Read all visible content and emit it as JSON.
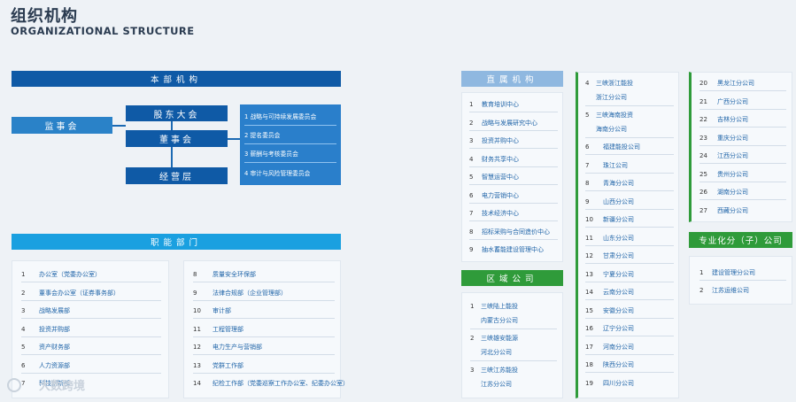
{
  "header": {
    "title_cn": "组织机构",
    "title_en": "ORGANIZATIONAL STRUCTURE"
  },
  "hq": {
    "label": "本部机构",
    "supervisors": "监事会",
    "shareholders": "股东大会",
    "board": "董事会",
    "management": "经营层",
    "committees": [
      "1  战略与可持续发展委员会",
      "2  提名委员会",
      "3  薪酬与考核委员会",
      "4  审计与风险管理委员会"
    ]
  },
  "functional": {
    "label": "职能部门",
    "left": [
      {
        "n": "1",
        "t": "办公室（党委办公室）"
      },
      {
        "n": "2",
        "t": "董事会办公室（证券事务部）"
      },
      {
        "n": "3",
        "t": "战略发展部"
      },
      {
        "n": "4",
        "t": "投资并购部"
      },
      {
        "n": "5",
        "t": "资产财务部"
      },
      {
        "n": "6",
        "t": "人力资源部"
      },
      {
        "n": "7",
        "t": "科技创新部"
      }
    ],
    "right": [
      {
        "n": "8",
        "t": "质量安全环保部"
      },
      {
        "n": "9",
        "t": "法律合规部（企业管理部）"
      },
      {
        "n": "10",
        "t": "审计部"
      },
      {
        "n": "11",
        "t": "工程管理部"
      },
      {
        "n": "12",
        "t": "电力生产与营销部"
      },
      {
        "n": "13",
        "t": "党群工作部"
      },
      {
        "n": "14",
        "t": "纪检工作部（党委巡察工作办公室、纪委办公室）"
      }
    ]
  },
  "direct": {
    "label": "直属机构",
    "items": [
      {
        "n": "1",
        "t": "教育培训中心"
      },
      {
        "n": "2",
        "t": "战略与发展研究中心"
      },
      {
        "n": "3",
        "t": "投资并购中心"
      },
      {
        "n": "4",
        "t": "财务共享中心"
      },
      {
        "n": "5",
        "t": "智慧运营中心"
      },
      {
        "n": "6",
        "t": "电力营销中心"
      },
      {
        "n": "7",
        "t": "技术经济中心"
      },
      {
        "n": "8",
        "t": "招标采购与合同造价中心"
      },
      {
        "n": "9",
        "t": "抽水蓄能建设管理中心"
      }
    ]
  },
  "regional": {
    "label": "区域公司",
    "items": [
      {
        "n": "1",
        "a": "三峡陆上能投",
        "b": "内蒙古分公司"
      },
      {
        "n": "2",
        "a": "三峡雄安能源",
        "b": "河北分公司"
      },
      {
        "n": "3",
        "a": "三峡江苏能投",
        "b": "江苏分公司"
      }
    ]
  },
  "branches_a": {
    "top": [
      {
        "n": "4",
        "a": "三峡浙江能投",
        "b": "浙江分公司"
      },
      {
        "n": "5",
        "a": "三峡海南投资",
        "b": "海南分公司"
      }
    ],
    "items": [
      {
        "n": "6",
        "t": "福建能投公司"
      },
      {
        "n": "7",
        "t": "珠江公司"
      },
      {
        "n": "8",
        "t": "青海分公司"
      },
      {
        "n": "9",
        "t": "山西分公司"
      },
      {
        "n": "10",
        "t": "新疆分公司"
      },
      {
        "n": "11",
        "t": "山东分公司"
      },
      {
        "n": "12",
        "t": "甘肃分公司"
      },
      {
        "n": "13",
        "t": "宁夏分公司"
      },
      {
        "n": "14",
        "t": "云南分公司"
      },
      {
        "n": "15",
        "t": "安徽分公司"
      },
      {
        "n": "16",
        "t": "辽宁分公司"
      },
      {
        "n": "17",
        "t": "河南分公司"
      },
      {
        "n": "18",
        "t": "陕西分公司"
      },
      {
        "n": "19",
        "t": "四川分公司"
      }
    ]
  },
  "branches_b": {
    "items": [
      {
        "n": "20",
        "t": "黑龙江分公司"
      },
      {
        "n": "21",
        "t": "广西分公司"
      },
      {
        "n": "22",
        "t": "吉林分公司"
      },
      {
        "n": "23",
        "t": "重庆分公司"
      },
      {
        "n": "24",
        "t": "江西分公司"
      },
      {
        "n": "25",
        "t": "贵州分公司"
      },
      {
        "n": "26",
        "t": "湖南分公司"
      },
      {
        "n": "27",
        "t": "西藏分公司"
      }
    ]
  },
  "specialized": {
    "label": "专业化分（子）公司",
    "items": [
      {
        "n": "1",
        "t": "建设管理分公司"
      },
      {
        "n": "2",
        "t": "江苏运维公司"
      }
    ]
  },
  "watermark": {
    "text": "大数跨境"
  }
}
